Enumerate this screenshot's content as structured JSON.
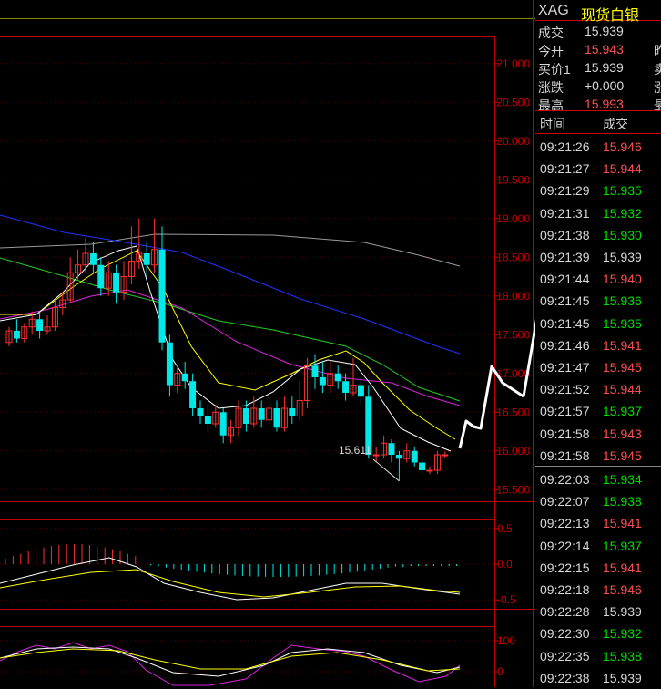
{
  "header": {
    "symbol": "XAG",
    "name": "现货白银"
  },
  "quote": [
    {
      "label": "成交",
      "value": "15.939",
      "color": "#d8d8d8",
      "extra": ""
    },
    {
      "label": "今开",
      "value": "15.943",
      "color": "#ff5050",
      "extra": "昨"
    },
    {
      "label": "买价1",
      "value": "15.939",
      "color": "#d8d8d8",
      "extra": "卖"
    },
    {
      "label": "涨跌",
      "value": "+0.000",
      "color": "#d8d8d8",
      "extra": "涨"
    },
    {
      "label": "最高",
      "value": "15.993",
      "color": "#ff5050",
      "extra": "最"
    }
  ],
  "ticks_header": {
    "time": "时间",
    "price": "成交"
  },
  "ticks": [
    {
      "time": "09:21:26",
      "price": "15.946",
      "color": "#ff5050"
    },
    {
      "time": "09:21:27",
      "price": "15.944",
      "color": "#ff5050"
    },
    {
      "time": "09:21:29",
      "price": "15.935",
      "color": "#00e000"
    },
    {
      "time": "09:21:31",
      "price": "15.932",
      "color": "#00e000"
    },
    {
      "time": "09:21:38",
      "price": "15.930",
      "color": "#00e000"
    },
    {
      "time": "09:21:39",
      "price": "15.939",
      "color": "#d8d8d8"
    },
    {
      "time": "09:21:44",
      "price": "15.940",
      "color": "#ff5050"
    },
    {
      "time": "09:21:45",
      "price": "15.936",
      "color": "#00e000"
    },
    {
      "time": "09:21:45",
      "price": "15.935",
      "color": "#00e000"
    },
    {
      "time": "09:21:46",
      "price": "15.941",
      "color": "#ff5050"
    },
    {
      "time": "09:21:47",
      "price": "15.945",
      "color": "#ff5050"
    },
    {
      "time": "09:21:52",
      "price": "15.944",
      "color": "#ff5050"
    },
    {
      "time": "09:21:57",
      "price": "15.937",
      "color": "#00e000"
    },
    {
      "time": "09:21:58",
      "price": "15.943",
      "color": "#ff5050"
    },
    {
      "time": "09:21:58",
      "price": "15.945",
      "color": "#ff5050"
    },
    {
      "time": "09:22:03",
      "price": "15.934",
      "color": "#00e000"
    },
    {
      "time": "09:22:07",
      "price": "15.938",
      "color": "#00e000"
    },
    {
      "time": "09:22:13",
      "price": "15.941",
      "color": "#ff5050"
    },
    {
      "time": "09:22:14",
      "price": "15.937",
      "color": "#00e000"
    },
    {
      "time": "09:22:15",
      "price": "15.941",
      "color": "#ff5050"
    },
    {
      "time": "09:22:18",
      "price": "15.946",
      "color": "#ff5050"
    },
    {
      "time": "09:22:28",
      "price": "15.939",
      "color": "#d8d8d8"
    },
    {
      "time": "09:22:30",
      "price": "15.932",
      "color": "#00e000"
    },
    {
      "time": "09:22:35",
      "price": "15.938",
      "color": "#00e000"
    },
    {
      "time": "09:22:38",
      "price": "15.939",
      "color": "#d8d8d8"
    }
  ],
  "chart_data": [
    {
      "type": "candlestick",
      "yticks": [
        "21.000",
        "20.500",
        "20.000",
        "19.500",
        "19.000",
        "18.500",
        "18.000",
        "17.500",
        "17.000",
        "16.500",
        "16.000",
        "15.500"
      ],
      "ylim": [
        15.35,
        21.35
      ],
      "annotation": "15.611",
      "candles": [
        [
          17.4,
          17.55,
          17.35,
          17.6
        ],
        [
          17.55,
          17.45,
          17.4,
          17.7
        ],
        [
          17.45,
          17.6,
          17.4,
          17.65
        ],
        [
          17.6,
          17.7,
          17.5,
          17.8
        ],
        [
          17.7,
          17.55,
          17.45,
          17.8
        ],
        [
          17.55,
          17.6,
          17.5,
          17.75
        ],
        [
          17.6,
          17.85,
          17.55,
          17.95
        ],
        [
          17.85,
          17.95,
          17.75,
          18.05
        ],
        [
          17.95,
          18.3,
          17.9,
          18.5
        ],
        [
          18.3,
          18.4,
          18.2,
          18.6
        ],
        [
          18.4,
          18.55,
          18.3,
          18.75
        ],
        [
          18.55,
          18.4,
          18.3,
          18.7
        ],
        [
          18.4,
          18.1,
          18.0,
          18.5
        ],
        [
          18.1,
          18.3,
          18.0,
          18.45
        ],
        [
          18.3,
          18.05,
          17.9,
          18.4
        ],
        [
          18.05,
          18.25,
          17.95,
          18.45
        ],
        [
          18.25,
          18.45,
          18.15,
          18.9
        ],
        [
          18.45,
          18.55,
          18.35,
          19.0
        ],
        [
          18.55,
          18.4,
          18.25,
          18.7
        ],
        [
          18.4,
          18.6,
          18.3,
          19.0
        ],
        [
          18.6,
          17.4,
          17.3,
          18.9
        ],
        [
          17.4,
          16.85,
          16.7,
          17.5
        ],
        [
          16.85,
          17.0,
          16.75,
          17.1
        ],
        [
          17.0,
          16.9,
          16.8,
          17.15
        ],
        [
          16.9,
          16.55,
          16.45,
          17.0
        ],
        [
          16.55,
          16.45,
          16.35,
          16.65
        ],
        [
          16.45,
          16.35,
          16.25,
          16.6
        ],
        [
          16.35,
          16.5,
          16.3,
          16.6
        ],
        [
          16.5,
          16.2,
          16.1,
          16.55
        ],
        [
          16.2,
          16.3,
          16.1,
          16.4
        ],
        [
          16.3,
          16.55,
          16.2,
          16.65
        ],
        [
          16.55,
          16.35,
          16.25,
          16.65
        ],
        [
          16.35,
          16.55,
          16.3,
          16.7
        ],
        [
          16.55,
          16.4,
          16.3,
          16.65
        ],
        [
          16.4,
          16.55,
          16.35,
          16.7
        ],
        [
          16.55,
          16.3,
          16.25,
          16.65
        ],
        [
          16.3,
          16.55,
          16.25,
          16.7
        ],
        [
          16.55,
          16.45,
          16.35,
          16.7
        ],
        [
          16.45,
          16.65,
          16.4,
          16.9
        ],
        [
          16.65,
          17.1,
          16.55,
          17.2
        ],
        [
          17.1,
          16.95,
          16.8,
          17.25
        ],
        [
          16.95,
          16.85,
          16.75,
          17.15
        ],
        [
          16.85,
          17.0,
          16.75,
          17.15
        ],
        [
          17.0,
          16.9,
          16.8,
          17.1
        ],
        [
          16.9,
          16.75,
          16.65,
          17.0
        ],
        [
          16.75,
          16.85,
          16.7,
          17.2
        ],
        [
          16.85,
          16.7,
          16.6,
          16.95
        ],
        [
          16.7,
          15.95,
          15.9,
          16.85
        ],
        [
          15.95,
          15.95,
          15.85,
          16.05
        ],
        [
          15.95,
          16.1,
          15.9,
          16.2
        ],
        [
          16.1,
          15.95,
          15.85,
          16.15
        ],
        [
          15.95,
          15.9,
          15.61,
          16.0
        ],
        [
          15.9,
          16.0,
          15.85,
          16.1
        ],
        [
          16.0,
          15.85,
          15.8,
          16.05
        ],
        [
          15.85,
          15.75,
          15.7,
          15.9
        ],
        [
          15.75,
          15.75,
          15.7,
          15.8
        ],
        [
          15.75,
          15.95,
          15.7,
          16.0
        ],
        [
          15.95,
          15.95,
          15.9,
          15.99
        ]
      ]
    },
    {
      "type": "histogram+line",
      "yticks": [
        "0.5",
        "0.0",
        "-0.5"
      ],
      "ylim": [
        -0.5,
        0.5
      ]
    },
    {
      "type": "line",
      "yticks": [
        "100",
        "0"
      ],
      "ylim": [
        0,
        100
      ]
    }
  ]
}
